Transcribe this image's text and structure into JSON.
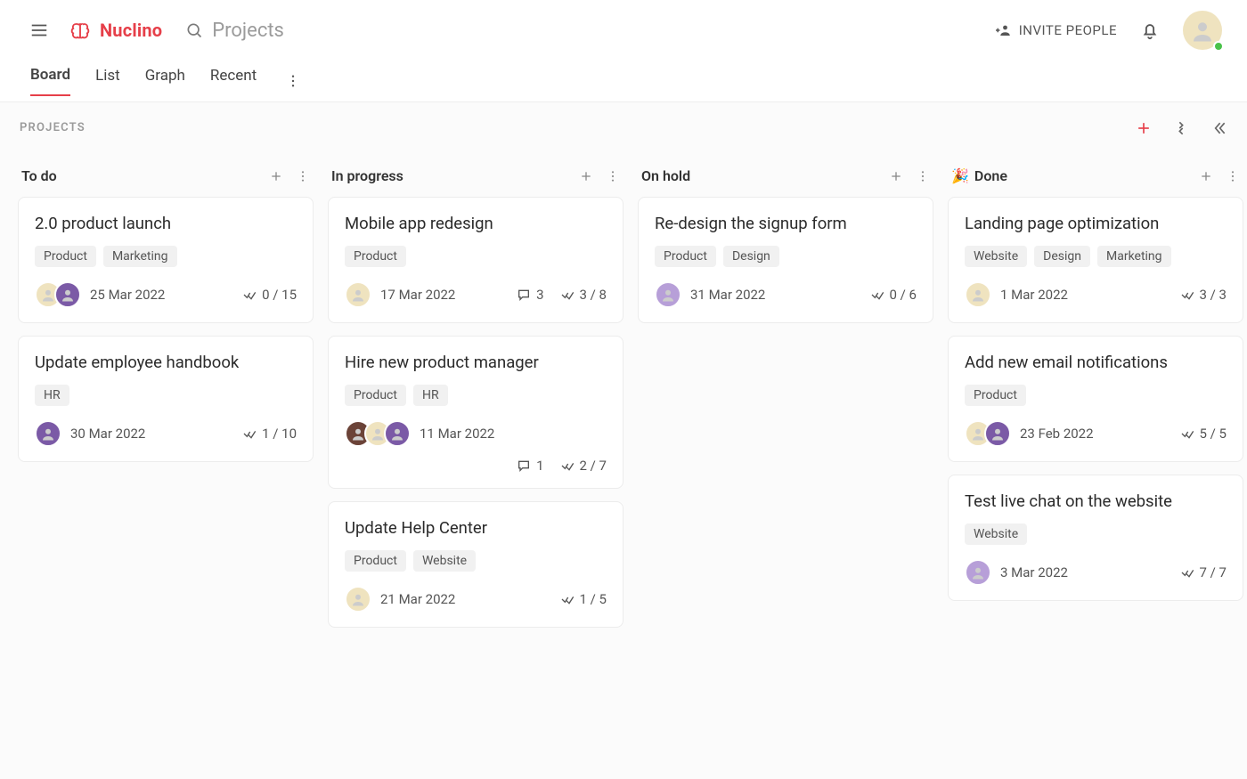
{
  "brand": "Nuclino",
  "search_placeholder": "Projects",
  "invite_label": "INVITE PEOPLE",
  "view_tabs": [
    "Board",
    "List",
    "Graph",
    "Recent"
  ],
  "active_view": "Board",
  "section_title": "PROJECTS",
  "columns": [
    {
      "title": "To do",
      "emoji": "",
      "cards": [
        {
          "title": "2.0 product launch",
          "tags": [
            "Product",
            "Marketing"
          ],
          "avatars": [
            "cream",
            "purple"
          ],
          "date": "25 Mar 2022",
          "comments": null,
          "checklist": "0 / 15",
          "second_row": false
        },
        {
          "title": "Update employee handbook",
          "tags": [
            "HR"
          ],
          "avatars": [
            "purple"
          ],
          "date": "30 Mar 2022",
          "comments": null,
          "checklist": "1 / 10",
          "second_row": false
        }
      ]
    },
    {
      "title": "In progress",
      "emoji": "",
      "cards": [
        {
          "title": "Mobile app redesign",
          "tags": [
            "Product"
          ],
          "avatars": [
            "cream"
          ],
          "date": "17 Mar 2022",
          "comments": "3",
          "checklist": "3 / 8",
          "second_row": false
        },
        {
          "title": "Hire new product manager",
          "tags": [
            "Product",
            "HR"
          ],
          "avatars": [
            "brown",
            "cream",
            "purple"
          ],
          "date": "11 Mar 2022",
          "comments": "1",
          "checklist": "2 / 7",
          "second_row": true
        },
        {
          "title": "Update Help Center",
          "tags": [
            "Product",
            "Website"
          ],
          "avatars": [
            "cream"
          ],
          "date": "21 Mar 2022",
          "comments": null,
          "checklist": "1 / 5",
          "second_row": false
        }
      ]
    },
    {
      "title": "On hold",
      "emoji": "",
      "cards": [
        {
          "title": "Re-design the signup form",
          "tags": [
            "Product",
            "Design"
          ],
          "avatars": [
            "lav"
          ],
          "date": "31 Mar 2022",
          "comments": null,
          "checklist": "0 / 6",
          "second_row": false
        }
      ]
    },
    {
      "title": "Done",
      "emoji": "🎉",
      "cards": [
        {
          "title": "Landing page optimization",
          "tags": [
            "Website",
            "Design",
            "Marketing"
          ],
          "avatars": [
            "cream"
          ],
          "date": "1 Mar 2022",
          "comments": null,
          "checklist": "3 / 3",
          "second_row": false
        },
        {
          "title": "Add new email notifications",
          "tags": [
            "Product"
          ],
          "avatars": [
            "cream",
            "purple"
          ],
          "date": "23 Feb 2022",
          "comments": null,
          "checklist": "5 / 5",
          "second_row": false
        },
        {
          "title": "Test live chat on the website",
          "tags": [
            "Website"
          ],
          "avatars": [
            "lav"
          ],
          "date": "3 Mar 2022",
          "comments": null,
          "checklist": "7 / 7",
          "second_row": false
        }
      ]
    }
  ]
}
